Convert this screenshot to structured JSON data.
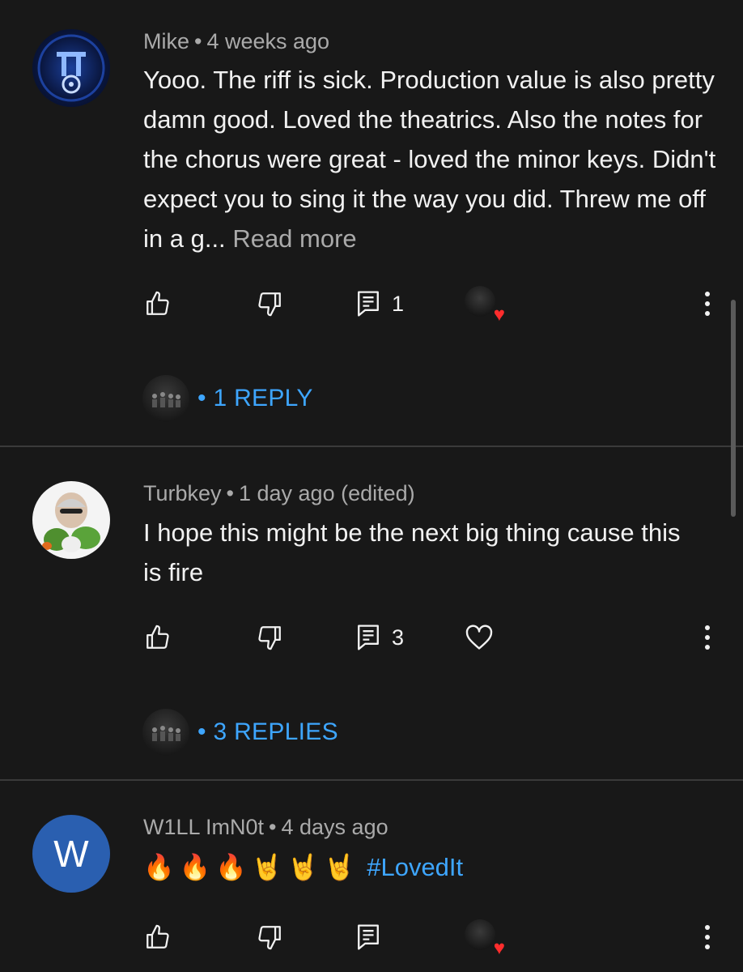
{
  "comments": [
    {
      "author": "Mike",
      "time": "4 weeks ago",
      "text": "Yooo. The riff is sick. Production value is also pretty damn good. Loved the theatrics. Also the notes for the chorus were great - loved the minor keys. Didn't expect you to sing it the way you did. Threw me off in a g...",
      "read_more": "Read more",
      "reply_count": "1",
      "replies_label": "1 REPLY",
      "creator_hearted": true
    },
    {
      "author": "Turbkey",
      "time": "1 day ago (edited)",
      "text": "I hope this might be the next big thing cause this is fire",
      "reply_count": "3",
      "replies_label": "3 REPLIES",
      "creator_hearted": false
    },
    {
      "author": "W1LL ImN0t",
      "time": "4 days ago",
      "avatar_letter": "W",
      "avatar_color": "#2a5fb0",
      "emojis": "🔥🔥🔥🤘🤘🤘",
      "hashtag": "#LovedIt",
      "creator_hearted": true
    }
  ],
  "separator": "•",
  "colors": {
    "background": "#181818",
    "link": "#3ea6ff",
    "muted": "#aaaaaa",
    "heart": "#ff2d2d"
  },
  "icons": [
    "like-icon",
    "dislike-icon",
    "reply-icon",
    "heart-icon",
    "more-vert-icon"
  ]
}
